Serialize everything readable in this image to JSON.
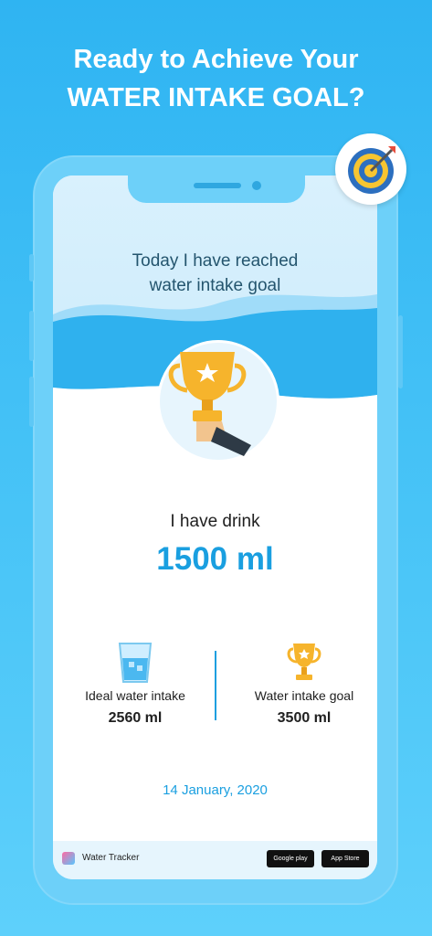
{
  "headline": {
    "line1": "Ready to Achieve Your",
    "line2": "WATER INTAKE GOAL?"
  },
  "icons": {
    "badge": "target-icon",
    "trophy": "trophy-hand-icon",
    "glass": "water-glass-icon",
    "goal": "trophy-icon",
    "app": "app-logo-icon"
  },
  "screen": {
    "title_line1": "Today I have reached",
    "title_line2": "water intake goal",
    "drink_label": "I have drink",
    "drink_value": "1500 ml",
    "stats": [
      {
        "label": "Ideal water intake",
        "value": "2560 ml"
      },
      {
        "label": "Water intake goal",
        "value": "3500 ml"
      }
    ],
    "date": "14 January, 2020"
  },
  "footer": {
    "app_name": "Water Tracker",
    "google_play": "Google play",
    "app_store": "App Store"
  },
  "colors": {
    "accent": "#1a9fe0",
    "background": "#2fb4f2",
    "trophy_gold": "#f6b42c"
  }
}
